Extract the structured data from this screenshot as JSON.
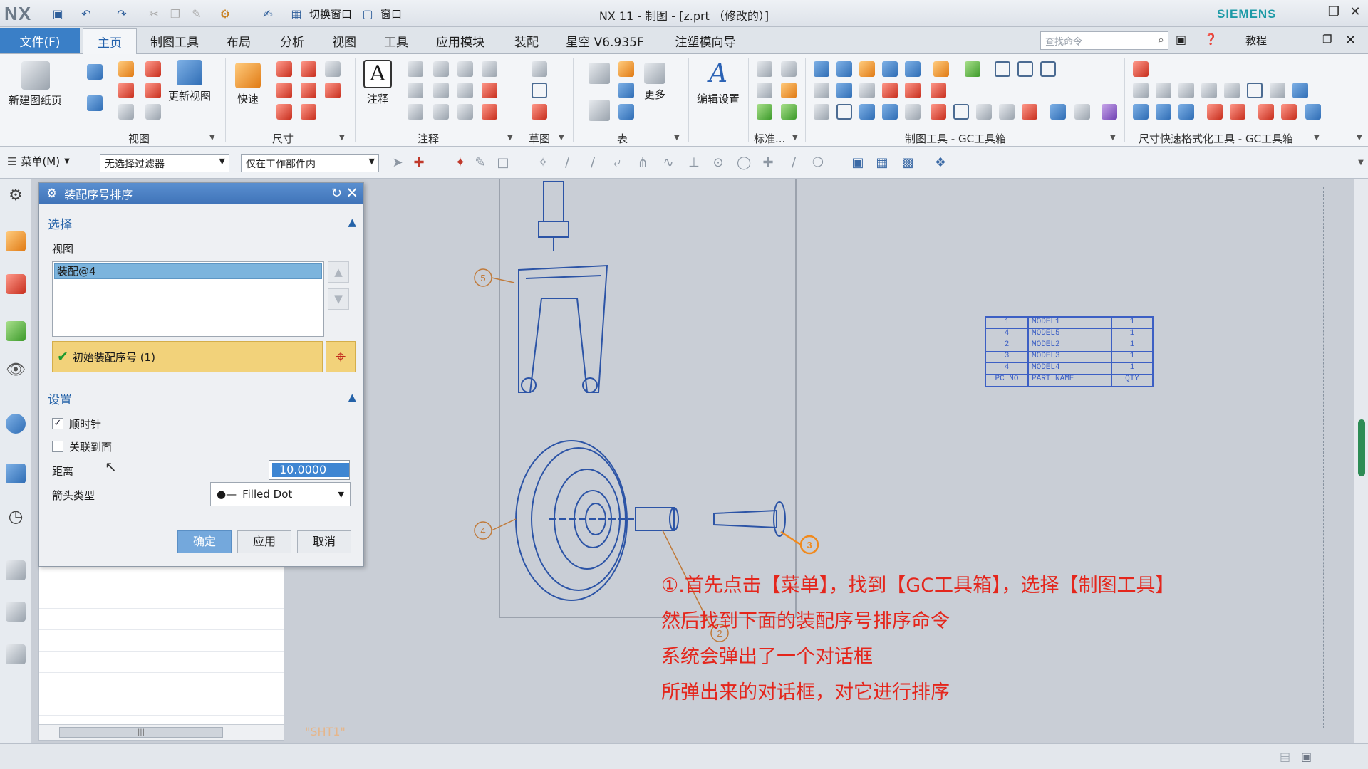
{
  "window": {
    "logo": "NX",
    "title": "NX 11 - 制图 - [z.prt （修改的）]",
    "brand": "SIEMENS",
    "switch_window": "切换窗口",
    "window_menu": "窗口"
  },
  "tabs": {
    "file": "文件(F)",
    "items": [
      "主页",
      "制图工具",
      "布局",
      "分析",
      "视图",
      "工具",
      "应用模块",
      "装配",
      "星空 V6.935F",
      "注塑模向导"
    ],
    "search_placeholder": "查找命令",
    "tutorial": "教程"
  },
  "ribbon": {
    "new_sheet": "新建图纸页",
    "update_view": "更新视图",
    "quick": "快速",
    "note": "注释",
    "more": "更多",
    "edit_settings": "编辑设置",
    "groups": {
      "view": "视图",
      "dimension": "尺寸",
      "annotation": "注释",
      "sketch": "草图",
      "table": "表",
      "standard": "标准...",
      "gc_tools": "制图工具 - GC工具箱",
      "dim_format": "尺寸快速格式化工具 - GC工具箱"
    }
  },
  "selbar": {
    "menu": "菜单(M)",
    "filter": "无选择过滤器",
    "scope": "仅在工作部件内"
  },
  "dialog": {
    "title": "装配序号排序",
    "section_select": "选择",
    "view_label": "视图",
    "view_item": "装配@4",
    "initial_balloon": "初始装配序号 (1)",
    "section_settings": "设置",
    "clockwise": "顺时针",
    "clockwise_checked": true,
    "associate_face": "关联到面",
    "associate_face_checked": false,
    "distance_label": "距离",
    "distance_value": "10.0000",
    "arrow_type_label": "箭头类型",
    "arrow_type_value": "Filled Dot",
    "ok": "确定",
    "apply": "应用",
    "cancel": "取消"
  },
  "drawing": {
    "sheet_label": "\"SHT1\"",
    "balloons": [
      "5",
      "4",
      "3",
      "2"
    ],
    "parts_table": {
      "rows": [
        {
          "pc": "1",
          "name": "MODEL1",
          "qty": "1"
        },
        {
          "pc": "4",
          "name": "MODEL5",
          "qty": "1"
        },
        {
          "pc": "2",
          "name": "MODEL2",
          "qty": "1"
        },
        {
          "pc": "3",
          "name": "MODEL3",
          "qty": "1"
        },
        {
          "pc": "4",
          "name": "MODEL4",
          "qty": "1"
        }
      ],
      "header": {
        "pc": "PC NO",
        "name": "PART NAME",
        "qty": "QTY"
      }
    }
  },
  "annotation": {
    "line1": "①.首先点击【菜单】，找到【GC工具箱】，选择【制图工具】",
    "line2": "然后找到下面的装配序号排序命令",
    "line3": "系统会弹出了一个对话框",
    "line4": "所弹出来的对话框，对它进行排序",
    "color": "#e4261c"
  }
}
